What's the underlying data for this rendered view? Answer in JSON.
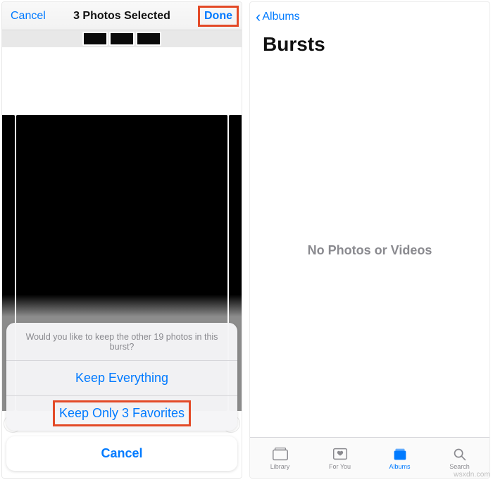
{
  "left": {
    "nav": {
      "cancel": "Cancel",
      "title": "3 Photos Selected",
      "done": "Done"
    },
    "sheet": {
      "message": "Would you like to keep the other 19 photos in this burst?",
      "keep_all": "Keep Everything",
      "keep_favs": "Keep Only 3 Favorites",
      "cancel": "Cancel"
    }
  },
  "right": {
    "back": "Albums",
    "title": "Bursts",
    "empty": "No Photos or Videos",
    "tabs": {
      "library": "Library",
      "foryou": "For You",
      "albums": "Albums",
      "search": "Search"
    }
  },
  "watermark": "wsxdn.com"
}
